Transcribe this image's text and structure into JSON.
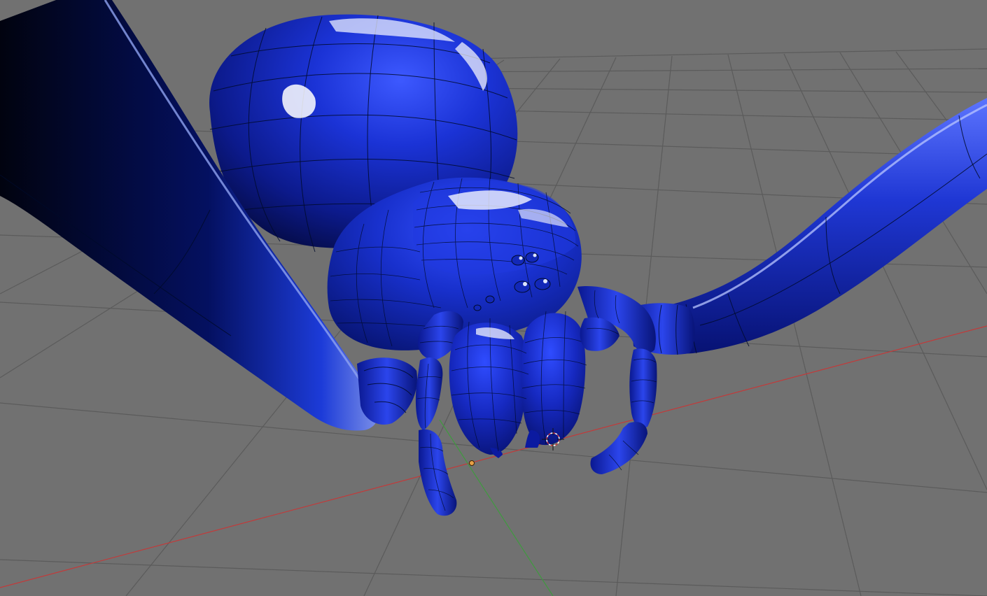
{
  "app": {
    "name": "",
    "view": "3D viewport"
  },
  "scene": {
    "object": "spider-model",
    "material_color": "#1a2fc4",
    "shadow_color": "#020620",
    "highlight_color": "#dfe6ff",
    "background_color": "#717171",
    "grid_color": "#5b5b5b",
    "x_axis_color": "#c23a3a",
    "y_axis_color": "#3f9a3f",
    "origin_color": "#e8a045",
    "wireframe_overlay": true
  }
}
